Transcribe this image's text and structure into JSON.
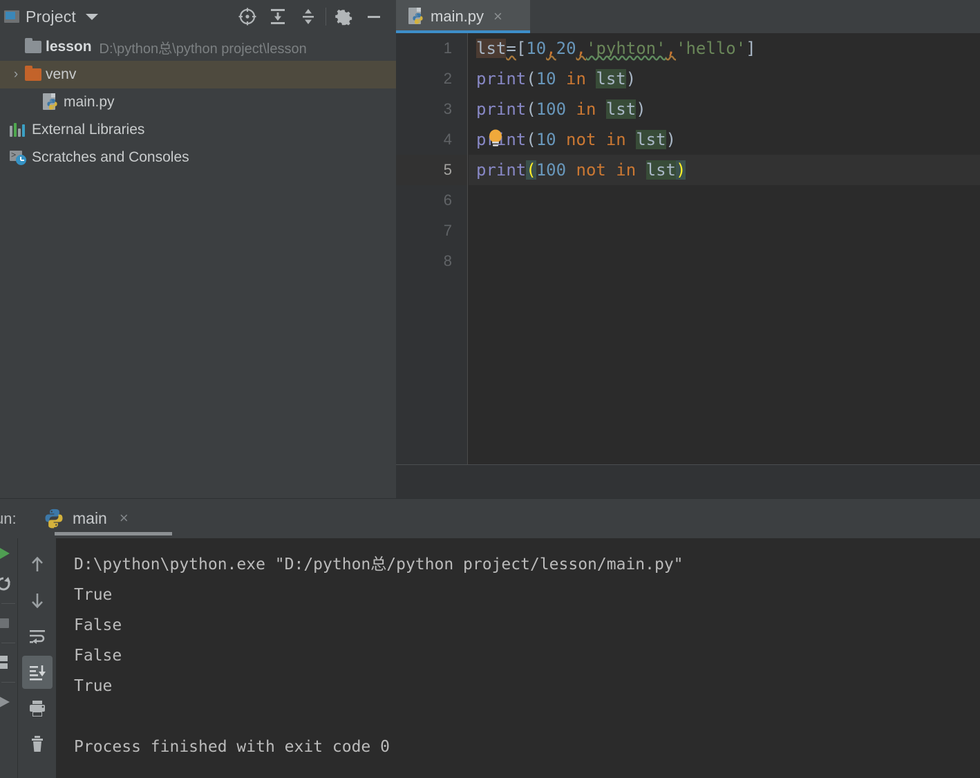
{
  "project_panel": {
    "title": "Project",
    "window_icon": "project-window-icon",
    "dropdown_icon": "chevron-down-icon",
    "actions": [
      {
        "name": "select-opened-file-button",
        "icon": "crosshair-target-icon"
      },
      {
        "name": "expand-all-button",
        "icon": "expand-all-icon"
      },
      {
        "name": "collapse-all-button",
        "icon": "collapse-all-icon"
      },
      {
        "name": "settings-button",
        "icon": "gear-icon"
      },
      {
        "name": "hide-panel-button",
        "icon": "minimize-icon"
      }
    ],
    "tree": [
      {
        "label": "lesson",
        "path": "D:\\python总\\python project\\lesson",
        "icon": "folder-gray-icon",
        "arrow": "",
        "selected": false,
        "level": 0
      },
      {
        "label": "venv",
        "path": "",
        "icon": "folder-orange-icon",
        "arrow": "›",
        "selected": true,
        "level": 1
      },
      {
        "label": "main.py",
        "path": "",
        "icon": "python-file-icon",
        "arrow": "",
        "selected": false,
        "level": 2
      },
      {
        "label": "External Libraries",
        "path": "",
        "icon": "external-libraries-icon",
        "arrow": "",
        "selected": false,
        "level": 0
      },
      {
        "label": "Scratches and Consoles",
        "path": "",
        "icon": "scratches-consoles-icon",
        "arrow": "",
        "selected": false,
        "level": 0
      }
    ]
  },
  "editor": {
    "tab": {
      "label": "main.py",
      "icon": "python-file-icon",
      "close_icon": "×"
    },
    "line_numbers": [
      "1",
      "2",
      "3",
      "4",
      "5",
      "6",
      "7",
      "8"
    ],
    "current_line": 5,
    "lines": [
      "lst=[10,20,'pyhton','hello']",
      "print(10 in lst)",
      "print(100 in lst)",
      "print(10 not in lst)",
      "print(100 not in lst)",
      "",
      "",
      ""
    ],
    "intention_bulb_icon": "lightbulb-icon",
    "tokens": {
      "line1": {
        "var": "lst",
        "eq": "=",
        "lb": "[",
        "n1": "10",
        "c1": ",",
        "n2": "20",
        "c2": ",",
        "s1": "'pyhton'",
        "c3": ",",
        "s2": "'hello'",
        "rb": "]"
      },
      "line2": {
        "fn": "print",
        "lp": "(",
        "n": "10",
        "kw": " in ",
        "var": "lst",
        "rp": ")"
      },
      "line3": {
        "fn": "print",
        "lp": "(",
        "n": "100",
        "kw": " in ",
        "var": "lst",
        "rp": ")"
      },
      "line4": {
        "fn": "p",
        "fn2": "rint",
        "lp": "(",
        "n": "10",
        "kw": " not in ",
        "var": "lst",
        "rp": ")"
      },
      "line5": {
        "fn": "print",
        "lp": "(",
        "n": "100",
        "kw": " not in ",
        "var": "lst",
        "rp": ")"
      }
    }
  },
  "run_panel": {
    "label": "un:",
    "tab": {
      "label": "main",
      "icon": "python-icon",
      "close_icon": "×"
    },
    "far_actions": [
      {
        "name": "run-button",
        "icon": "run-play-icon"
      },
      {
        "name": "rerun-button",
        "icon": "rerun-icon"
      },
      {
        "name": "stop-button",
        "icon": "stop-square-icon"
      },
      {
        "name": "layout-button",
        "icon": "layout-icon"
      },
      {
        "name": "resume-button",
        "icon": "resume-play-icon"
      }
    ],
    "toolbar_actions": [
      {
        "name": "scroll-up-button",
        "icon": "arrow-up-icon",
        "active": false
      },
      {
        "name": "scroll-down-button",
        "icon": "arrow-down-icon",
        "active": false
      },
      {
        "name": "soft-wrap-button",
        "icon": "soft-wrap-icon",
        "active": false
      },
      {
        "name": "scroll-to-end-button",
        "icon": "scroll-to-end-icon",
        "active": true
      },
      {
        "name": "print-button",
        "icon": "printer-icon",
        "active": false
      },
      {
        "name": "clear-all-button",
        "icon": "trash-icon",
        "active": false
      }
    ],
    "console_output": [
      "D:\\python\\python.exe \"D:/python总/python project/lesson/main.py\"",
      "True",
      "False",
      "False",
      "True",
      "",
      "Process finished with exit code 0"
    ]
  },
  "colors": {
    "panel_bg": "#3c3f41",
    "editor_bg": "#2b2b2b",
    "gutter_bg": "#313335",
    "tab_active_bg": "#4e5254",
    "tab_accent": "#3d8ec9",
    "tree_selected_bg": "#4e4a3e",
    "folder_orange": "#c3632a",
    "text_primary": "#bbbbbb",
    "text_dim": "#7c8082",
    "token_number": "#6897bb",
    "token_string": "#6a8759",
    "token_keyword": "#cc7832",
    "token_function": "#8888c6",
    "bracket_match": "#ffef28"
  }
}
